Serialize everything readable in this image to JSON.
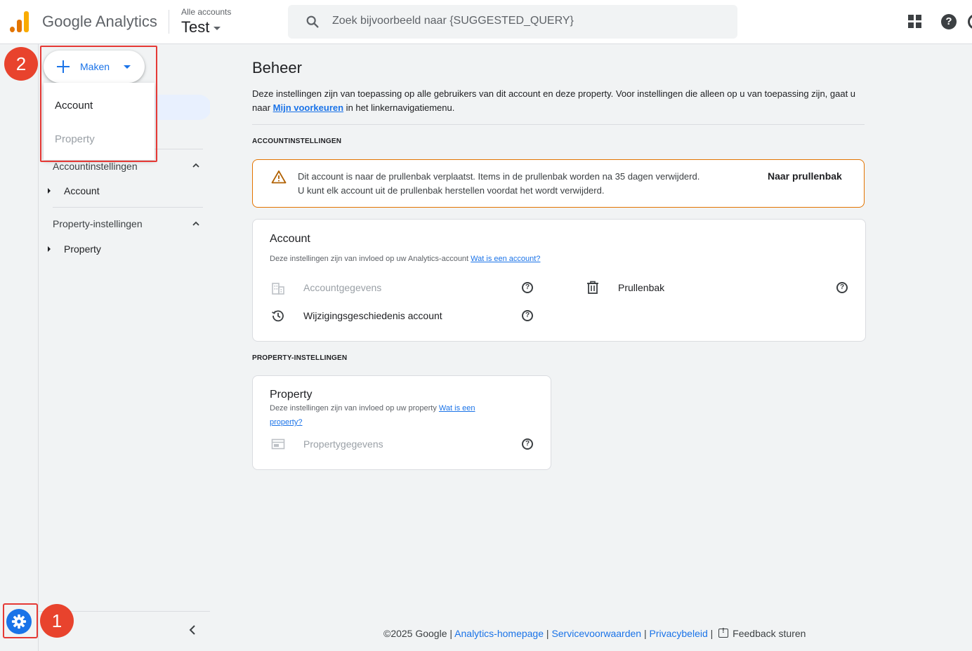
{
  "header": {
    "brand": "Google Analytics",
    "account_small": "Alle accounts",
    "account_big": "Test",
    "search_placeholder": "Zoek bijvoorbeeld naar {SUGGESTED_QUERY}"
  },
  "create": {
    "label": "Maken",
    "menu": [
      {
        "label": "Account",
        "enabled": true
      },
      {
        "label": "Property",
        "enabled": false
      }
    ]
  },
  "sidebar": {
    "sections": [
      {
        "title": "Accountinstellingen",
        "item": "Account"
      },
      {
        "title": "Property-instellingen",
        "item": "Property"
      }
    ]
  },
  "annotations": [
    "1",
    "2"
  ],
  "main": {
    "title": "Beheer",
    "desc_before": "Deze instellingen zijn van toepassing op alle gebruikers van dit account en deze property. Voor instellingen die alleen op u van toepassing zijn, gaat u naar ",
    "desc_link": "Mijn voorkeuren",
    "desc_after": " in het linkernavigatiemenu.",
    "account_section_label": "ACCOUNTINSTELLINGEN",
    "property_section_label": "PROPERTY-INSTELLINGEN"
  },
  "alert": {
    "line1": "Dit account is naar de prullenbak verplaatst. Items in de prullenbak worden na 35 dagen verwijderd.",
    "line2": "U kunt elk account uit de prullenbak herstellen voordat het wordt verwijderd.",
    "action": "Naar prullenbak"
  },
  "account_card": {
    "title": "Account",
    "desc": "Deze instellingen zijn van invloed op uw Analytics-account ",
    "desc_link": "Wat is een account?",
    "rows": [
      {
        "label": "Accountgegevens",
        "enabled": false
      },
      {
        "label": "Prullenbak",
        "enabled": true
      },
      {
        "label": "Wijzigingsgeschiedenis account",
        "enabled": true
      }
    ]
  },
  "property_card": {
    "title": "Property",
    "desc": "Deze instellingen zijn van invloed op uw property ",
    "desc_link_1": "Wat is een",
    "desc_link_2": "property?",
    "rows": [
      {
        "label": "Propertygegevens",
        "enabled": false
      }
    ]
  },
  "footer": {
    "copyright": "©2025 Google",
    "links": [
      "Analytics-homepage",
      "Servicevoorwaarden",
      "Privacybeleid"
    ],
    "feedback": "Feedback sturen"
  },
  "colors": {
    "accent": "#1a73e8",
    "warning": "#e37400",
    "annotation": "#e8432d",
    "ga_orange": "#f9ab00",
    "ga_dark_orange": "#e37400"
  }
}
